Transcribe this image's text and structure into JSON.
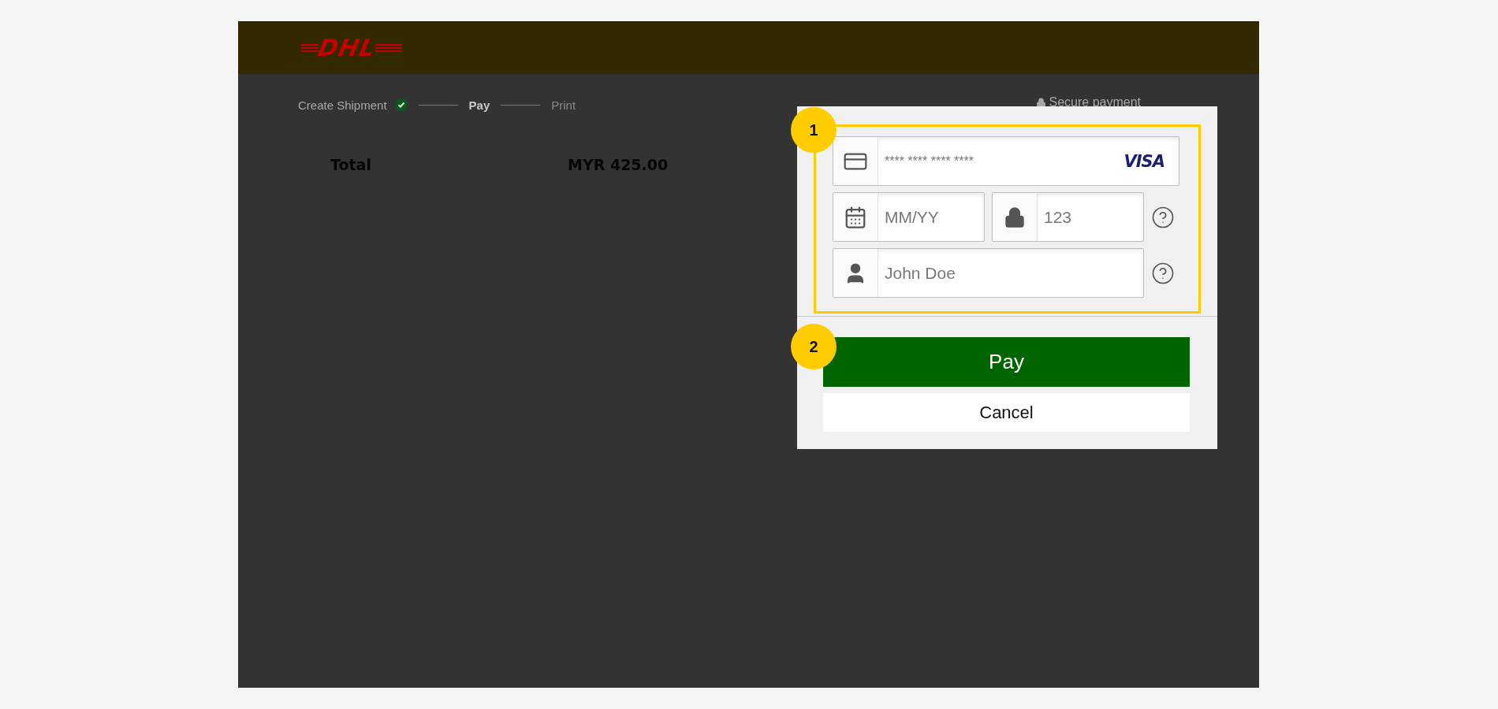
{
  "header": {
    "logo": "DHL"
  },
  "steps": [
    {
      "label": "Create Shipment",
      "completed": true,
      "selected": false
    },
    {
      "label": "Pay",
      "completed": false,
      "selected": true
    },
    {
      "label": "Print",
      "completed": false,
      "selected": false
    }
  ],
  "secure_label": "Secure payment",
  "summary": {
    "label": "Total",
    "amount": "MYR 425.00"
  },
  "payment_form": {
    "card_number": {
      "placeholder": "**** **** **** ****",
      "brand": "VISA"
    },
    "expiry": {
      "placeholder": "MM/YY"
    },
    "cvv": {
      "placeholder": "123"
    },
    "cardholder": {
      "placeholder": "John Doe"
    }
  },
  "buttons": [
    {
      "label": "Pay",
      "kind": "primary"
    },
    {
      "label": "Cancel",
      "kind": "secondary"
    }
  ],
  "callouts": [
    "1",
    "2"
  ]
}
